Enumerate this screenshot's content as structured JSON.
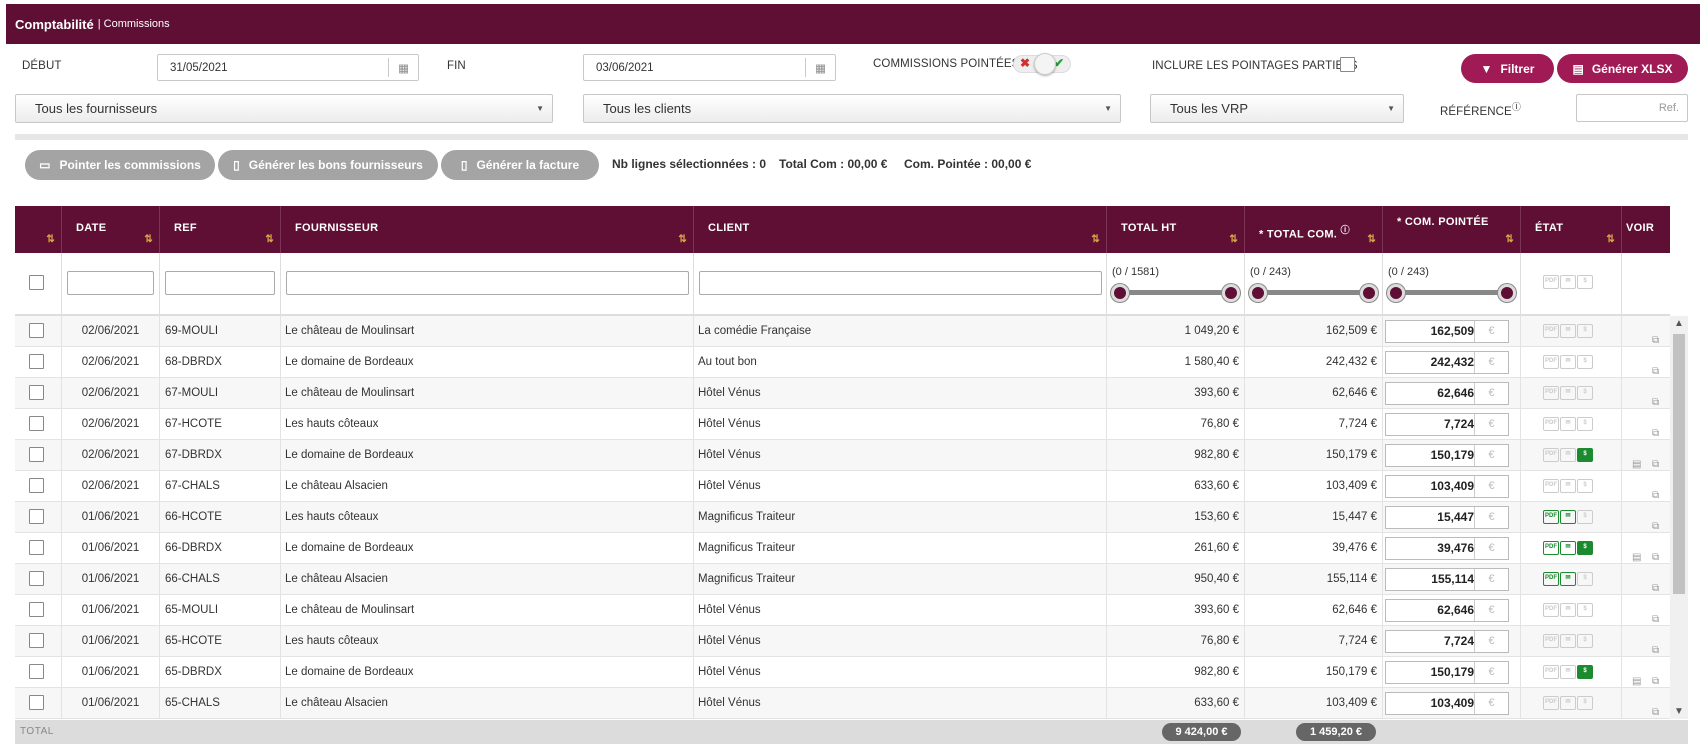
{
  "header": {
    "app": "Comptabilité",
    "page": "| Commissions"
  },
  "filters": {
    "debut_label": "DÉBUT",
    "debut_value": "31/05/2021",
    "fin_label": "FIN",
    "fin_value": "03/06/2021",
    "commissions_pointees_label": "COMMISSIONS POINTÉES",
    "inclure_label": "INCLURE LES POINTAGES PARTIELS",
    "filtrer": "Filtrer",
    "generer_xlsx": "Générer XLSX",
    "fournisseurs": "Tous les fournisseurs",
    "clients": "Tous les clients",
    "vrp": "Tous les VRP",
    "reference_label": "RÉFÉRENCE",
    "reference_placeholder": "Ref."
  },
  "actions": {
    "pointer": "Pointer les commissions",
    "bons": "Générer les bons fournisseurs",
    "facture": "Générer la facture",
    "nb_lignes": "Nb lignes sélectionnées : 0",
    "total_com": "Total Com : 00,00 €",
    "com_pointee": "Com. Pointée : 00,00 €"
  },
  "columns": {
    "date": "DATE",
    "ref": "REF",
    "fournisseur": "FOURNISSEUR",
    "client": "CLIENT",
    "total_ht": "TOTAL HT",
    "total_com": "* TOTAL COM.",
    "com_pointee": "* COM. POINTÉE",
    "etat": "ÉTAT",
    "voir": "VOIR"
  },
  "ranges": {
    "total_ht": "(0 / 1581)",
    "total_com": "(0 / 243)",
    "com_pointee": "(0 / 243)"
  },
  "currency": "€",
  "rows": [
    {
      "date": "02/06/2021",
      "ref": "69-MOULI",
      "fournisseur": "Le château de Moulinsart",
      "client": "La comédie Française",
      "total_ht": "1 049,20 €",
      "total_com": "162,509 €",
      "com_pointee": "162,509",
      "pdf": false,
      "mail": false,
      "money": false,
      "doc": false
    },
    {
      "date": "02/06/2021",
      "ref": "68-DBRDX",
      "fournisseur": "Le domaine de Bordeaux",
      "client": "Au tout bon",
      "total_ht": "1 580,40 €",
      "total_com": "242,432 €",
      "com_pointee": "242,432",
      "pdf": false,
      "mail": false,
      "money": false,
      "doc": false
    },
    {
      "date": "02/06/2021",
      "ref": "67-MOULI",
      "fournisseur": "Le château de Moulinsart",
      "client": "Hôtel Vénus",
      "total_ht": "393,60 €",
      "total_com": "62,646 €",
      "com_pointee": "62,646",
      "pdf": false,
      "mail": false,
      "money": false,
      "doc": false
    },
    {
      "date": "02/06/2021",
      "ref": "67-HCOTE",
      "fournisseur": "Les hauts côteaux",
      "client": "Hôtel Vénus",
      "total_ht": "76,80 €",
      "total_com": "7,724 €",
      "com_pointee": "7,724",
      "pdf": false,
      "mail": false,
      "money": false,
      "doc": false
    },
    {
      "date": "02/06/2021",
      "ref": "67-DBRDX",
      "fournisseur": "Le domaine de Bordeaux",
      "client": "Hôtel Vénus",
      "total_ht": "982,80 €",
      "total_com": "150,179 €",
      "com_pointee": "150,179",
      "pdf": false,
      "mail": false,
      "money": true,
      "doc": true
    },
    {
      "date": "02/06/2021",
      "ref": "67-CHALS",
      "fournisseur": "Le château Alsacien",
      "client": "Hôtel Vénus",
      "total_ht": "633,60 €",
      "total_com": "103,409 €",
      "com_pointee": "103,409",
      "pdf": false,
      "mail": false,
      "money": false,
      "doc": false
    },
    {
      "date": "01/06/2021",
      "ref": "66-HCOTE",
      "fournisseur": "Les hauts côteaux",
      "client": "Magnificus Traiteur",
      "total_ht": "153,60 €",
      "total_com": "15,447 €",
      "com_pointee": "15,447",
      "pdf": true,
      "mail": true,
      "money": false,
      "doc": false
    },
    {
      "date": "01/06/2021",
      "ref": "66-DBRDX",
      "fournisseur": "Le domaine de Bordeaux",
      "client": "Magnificus Traiteur",
      "total_ht": "261,60 €",
      "total_com": "39,476 €",
      "com_pointee": "39,476",
      "pdf": true,
      "mail": true,
      "money": true,
      "doc": true
    },
    {
      "date": "01/06/2021",
      "ref": "66-CHALS",
      "fournisseur": "Le château Alsacien",
      "client": "Magnificus Traiteur",
      "total_ht": "950,40 €",
      "total_com": "155,114 €",
      "com_pointee": "155,114",
      "pdf": true,
      "mail": true,
      "money": false,
      "doc": false
    },
    {
      "date": "01/06/2021",
      "ref": "65-MOULI",
      "fournisseur": "Le château de Moulinsart",
      "client": "Hôtel Vénus",
      "total_ht": "393,60 €",
      "total_com": "62,646 €",
      "com_pointee": "62,646",
      "pdf": false,
      "mail": false,
      "money": false,
      "doc": false
    },
    {
      "date": "01/06/2021",
      "ref": "65-HCOTE",
      "fournisseur": "Les hauts côteaux",
      "client": "Hôtel Vénus",
      "total_ht": "76,80 €",
      "total_com": "7,724 €",
      "com_pointee": "7,724",
      "pdf": false,
      "mail": false,
      "money": false,
      "doc": false
    },
    {
      "date": "01/06/2021",
      "ref": "65-DBRDX",
      "fournisseur": "Le domaine de Bordeaux",
      "client": "Hôtel Vénus",
      "total_ht": "982,80 €",
      "total_com": "150,179 €",
      "com_pointee": "150,179",
      "pdf": false,
      "mail": false,
      "money": true,
      "doc": true
    },
    {
      "date": "01/06/2021",
      "ref": "65-CHALS",
      "fournisseur": "Le château Alsacien",
      "client": "Hôtel Vénus",
      "total_ht": "633,60 €",
      "total_com": "103,409 €",
      "com_pointee": "103,409",
      "pdf": false,
      "mail": false,
      "money": false,
      "doc": false
    }
  ],
  "footer": {
    "label": "TOTAL",
    "total_ht": "9 424,00 €",
    "total_com": "1 459,20 €"
  },
  "colors": {
    "brand": "#5e0f33",
    "button": "#a01a55",
    "valid": "#1c8a2e",
    "sort_icon": "#d9a64a"
  },
  "icons": {
    "calendar": "calendar-icon",
    "filter": "filter-icon",
    "xlsx": "file-xlsx-icon",
    "pdf": "pdf-icon",
    "mail": "mail-icon",
    "money": "money-icon",
    "voir": "stack-icon",
    "doc": "document-icon"
  }
}
